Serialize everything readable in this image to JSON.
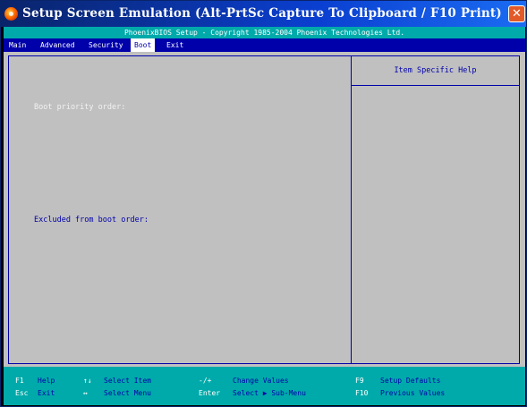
{
  "window": {
    "title": "Setup Screen Emulation (Alt-PrtSc Capture To Clipboard / F10 Print)",
    "close_symbol": "✕",
    "icon": "bios-app-icon"
  },
  "bios": {
    "header_line": "PhoenixBIOS Setup - Copyright 1985-2004 Phoenix Technologies Ltd.",
    "menu": [
      {
        "label": "Main",
        "active": false
      },
      {
        "label": "Advanced",
        "active": false
      },
      {
        "label": "Security",
        "active": false
      },
      {
        "label": "Boot",
        "active": true
      },
      {
        "label": "Exit",
        "active": false
      }
    ],
    "boot_priority_label": "Boot priority order:",
    "excluded_label": "Excluded from boot order:",
    "help_header": "Item Specific Help",
    "footer": {
      "row1": [
        {
          "key": "F1",
          "desc": "Help"
        },
        {
          "key": "↑↓",
          "desc": "Select Item"
        },
        {
          "key": "-/+",
          "desc": "Change Values"
        },
        {
          "key": "F9",
          "desc": "Setup Defaults"
        }
      ],
      "row2": [
        {
          "key": "Esc",
          "desc": "Exit"
        },
        {
          "key": "↔",
          "desc": "Select Menu"
        },
        {
          "key": "Enter",
          "desc": "Select ▶ Sub-Menu"
        },
        {
          "key": "F10",
          "desc": "Previous Values"
        }
      ]
    }
  },
  "colors": {
    "bios_background": "#c0c0c0",
    "bios_blue": "#0000aa",
    "bios_cyan": "#00aaaa",
    "title_bar": "#0a246a",
    "close_button": "#e25a28"
  }
}
